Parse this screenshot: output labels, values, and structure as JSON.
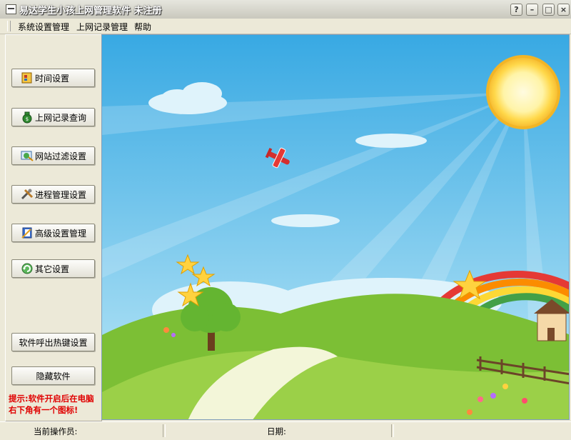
{
  "window": {
    "title": "易达学生小孩上网管理软件  未注册",
    "controls": {
      "help": "?",
      "minimize": "–",
      "maximize": "□",
      "close": "×"
    }
  },
  "menu": {
    "items": [
      "系统设置管理",
      "上网记录管理",
      "帮助"
    ]
  },
  "sidebar": {
    "buttons": [
      {
        "label": "时间设置",
        "icon": "clock-icon"
      },
      {
        "label": "上网记录查询",
        "icon": "money-bag-icon"
      },
      {
        "label": "网站过滤设置",
        "icon": "web-filter-icon"
      },
      {
        "label": "进程管理设置",
        "icon": "tools-icon"
      },
      {
        "label": "高级设置管理",
        "icon": "notebook-icon"
      },
      {
        "label": "其它设置",
        "icon": "refresh-icon"
      }
    ],
    "hotkey_button": "软件呼出热键设置",
    "hide_button": "隐藏软件",
    "hint": "提示:软件开启后在电脑右下角有一个图标!"
  },
  "status": {
    "operator_label": "当前操作员:",
    "date_label": "日期:"
  },
  "colors": {
    "sky_top": "#38a9e3",
    "sky_bottom": "#bfe9f7",
    "hill": "#8cc63e",
    "hint_text": "#e00000"
  }
}
